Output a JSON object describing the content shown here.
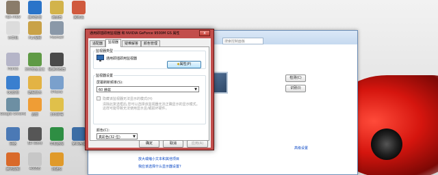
{
  "desktop_icons": [
    {
      "label": "cgs.copy",
      "color": "#8a7c6a"
    },
    {
      "label": "计算机",
      "color": "#dcdcdc"
    },
    {
      "label": "iTunes",
      "color": "#b5b5c8"
    },
    {
      "label": "QQ影音",
      "color": "#3a7fcf"
    },
    {
      "label": "Google Chrome",
      "color": "#6d8fa3"
    },
    {
      "label": "网络",
      "color": "#4b79b5"
    },
    {
      "label": "腾讯视频",
      "color": "#d96a2a"
    },
    {
      "label": "暴风影音",
      "color": "#2a74c9"
    },
    {
      "label": "FLV视频",
      "color": "#c9a247"
    },
    {
      "label": "360安全卫士",
      "color": "#5f9a45"
    },
    {
      "label": "酷我音乐",
      "color": "#e3b344"
    },
    {
      "label": "迅雷",
      "color": "#ef9d35"
    },
    {
      "label": "SR Word",
      "color": "#565656"
    },
    {
      "label": "4005B",
      "color": "#c7c7c7"
    },
    {
      "label": "播放器",
      "color": "#d2b34b"
    },
    {
      "label": "Foxmail",
      "color": "#8a98a8"
    },
    {
      "label": "极速浏览器",
      "color": "#4a4a4a"
    },
    {
      "label": "iPhone",
      "color": "#7aa0cc"
    },
    {
      "label": "360杀毒",
      "color": "#e0c04a"
    },
    {
      "label": "单机游戏",
      "color": "#2e8e43"
    },
    {
      "label": "扫描仪",
      "color": "#e09a2a"
    },
    {
      "label": "回收站",
      "color": "#d05a3e"
    },
    {
      "label": "宽带连接",
      "color": "#3d6ea5"
    }
  ],
  "background_window": {
    "search_placeholder": "搜索控制面板",
    "buttons": {
      "detect": "检测(C)",
      "identify": "识别(I)"
    },
    "links": {
      "advanced": "高级设置",
      "text_size": "放大或缩小文本和其他项目",
      "what_settings": "我应该选择什么显示器设置?"
    }
  },
  "dialog": {
    "title": "通用即插即用监视器 和 NVIDIA GeForce 9500M GS 属性",
    "close_glyph": "x",
    "tabs": [
      "适配器",
      "监视器",
      "疑难解答",
      "颜色管理"
    ],
    "active_tab_index": 1,
    "monitor_type": {
      "group_title": "监视器类型",
      "monitor_name": "通用即插即用监视器",
      "properties_button": "属性(P)"
    },
    "monitor_settings": {
      "group_title": "监视器设置",
      "refresh_label": "屏幕刷新频率(S):",
      "refresh_value": "60 赫兹",
      "hide_modes_label": "隐藏该监视器无法显示的模式(H)",
      "warning_text": "清除此复选框后,您可以选择该监视器无法正确显示的显示模式。这样可能导致无法使用显示且/或损坏硬件。"
    },
    "colors": {
      "label": "颜色(C):",
      "value": "真彩色(32 位)"
    },
    "buttons": {
      "ok": "确定",
      "cancel": "取消",
      "apply": "应用(A)"
    },
    "accent": "#c24e4c"
  }
}
